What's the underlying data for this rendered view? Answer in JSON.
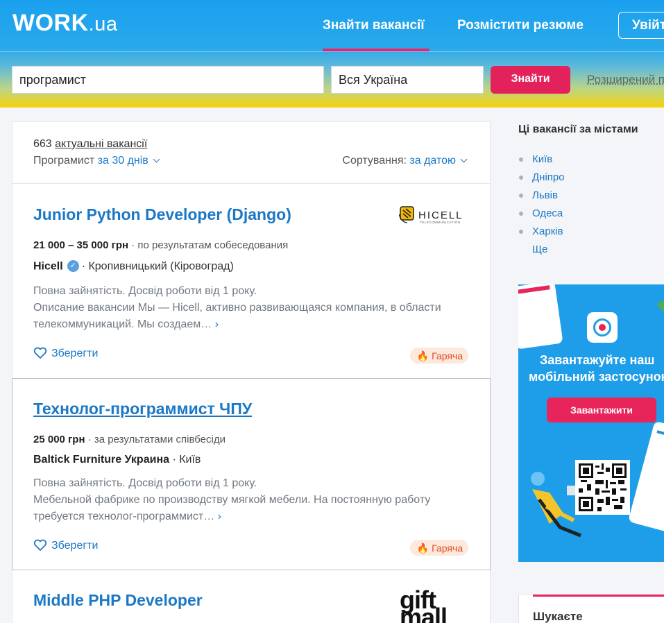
{
  "header": {
    "logo": "WORK",
    "logo_suffix": ".ua",
    "nav": [
      "Знайти вакансії",
      "Розмістити резюме"
    ],
    "login": "Увійти"
  },
  "search": {
    "query": "програмист",
    "region": "Вся Україна",
    "button": "Знайти",
    "advanced": "Розширений пошук"
  },
  "summary": {
    "count": "663",
    "count_label": "актуальні вакансії",
    "query": "Програмист",
    "period": "за 30 днів",
    "sort_label": "Сортування:",
    "sort_value": "за датою"
  },
  "jobs": [
    {
      "title": "Junior Python Developer (Django)",
      "salary": "21 000 – 35 000 грн",
      "salary_note": "· по результатам собеседования",
      "company": "Hicell",
      "location": "· Кропивницький (Кіровоград)",
      "desc1": "Повна зайнятість. Досвід роботи від 1 року.",
      "desc2": "Описание вакансии Мы — Hicell, активно развивающаяся компания, в области телекоммуникаций. Мы создаем…",
      "save": "Зберегти",
      "badge": "Гаряча",
      "logo_text": "HICELL",
      "logo_sub": "TELECOMMUNICATION"
    },
    {
      "title": "Технолог-программист ЧПУ",
      "salary": "25 000 грн",
      "salary_note": "· за результатами співбесіди",
      "company": "Baltick Furniture Украина",
      "location": "· Київ",
      "desc1": "Повна зайнятість. Досвід роботи від 1 року.",
      "desc2": "Мебельной фабрике по производству мягкой мебели. На постоянную работу требуется технолог-программист…",
      "save": "Зберегти",
      "badge": "Гаряча"
    },
    {
      "title": "Middle PHP Developer",
      "logo_text_1": "gift",
      "logo_text_2": "mall"
    }
  ],
  "sidebar": {
    "heading": "Ці вакансії за містами",
    "cities": [
      "Київ",
      "Дніпро",
      "Львів",
      "Одеса",
      "Харків"
    ],
    "more": "Ще",
    "banner_line1": "Завантажуйте наш",
    "banner_line2": "мобільний застосунок",
    "banner_button": "Завантажити",
    "box_title": "Шукаєте"
  },
  "colors": {
    "accent": "#e8256b",
    "link": "#1b78c6",
    "header_blue": "#1aa0ee",
    "header_yellow": "#f7d20a"
  }
}
